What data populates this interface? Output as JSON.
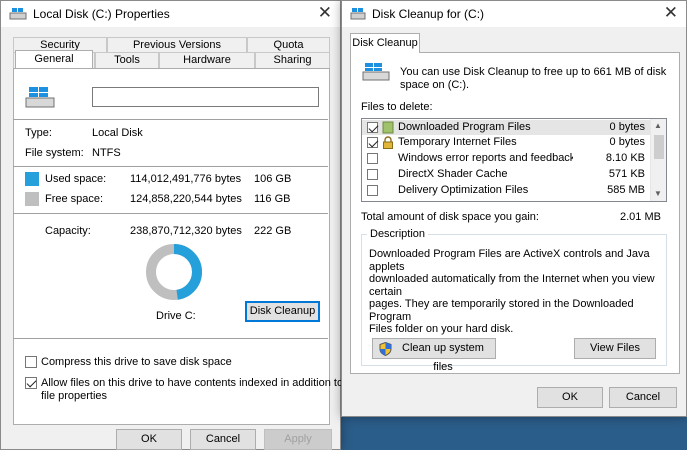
{
  "properties": {
    "title": "Local Disk (C:) Properties",
    "tabs_row1": [
      "Security",
      "Previous Versions",
      "Quota"
    ],
    "tabs_row2": [
      "General",
      "Tools",
      "Hardware",
      "Sharing"
    ],
    "volume_label_value": "",
    "type_label": "Type:",
    "type_value": "Local Disk",
    "fs_label": "File system:",
    "fs_value": "NTFS",
    "used_label": "Used space:",
    "used_bytes": "114,012,491,776 bytes",
    "used_gb": "106 GB",
    "free_label": "Free space:",
    "free_bytes": "124,858,220,544 bytes",
    "free_gb": "116 GB",
    "cap_label": "Capacity:",
    "cap_bytes": "238,870,712,320 bytes",
    "cap_gb": "222 GB",
    "drive_label": "Drive C:",
    "cleanup_button": "Disk Cleanup",
    "compress_label": "Compress this drive to save disk space",
    "compress_checked": false,
    "index_label_line1": "Allow files on this drive to have contents indexed in addition to",
    "index_label_line2": "file properties",
    "index_checked": true,
    "ok": "OK",
    "cancel": "Cancel",
    "apply": "Apply",
    "used_color": "#26a0da",
    "free_color": "#bfbfbf",
    "used_fraction": 0.477
  },
  "cleanup": {
    "title": "Disk Cleanup for  (C:)",
    "tab": "Disk Cleanup",
    "intro_line1": "You can use Disk Cleanup to free up to 661 MB of disk",
    "intro_line2": "space on  (C:).",
    "files_label": "Files to delete:",
    "files": [
      {
        "name": "Downloaded Program Files",
        "size": "0 bytes",
        "checked": true,
        "icon": "folder-icon"
      },
      {
        "name": "Temporary Internet Files",
        "size": "0 bytes",
        "checked": true,
        "icon": "lock-icon"
      },
      {
        "name": "Windows error reports and feedback di...",
        "size": "8.10 KB",
        "checked": false,
        "icon": "none"
      },
      {
        "name": "DirectX Shader Cache",
        "size": "571 KB",
        "checked": false,
        "icon": "none"
      },
      {
        "name": "Delivery Optimization Files",
        "size": "585 MB",
        "checked": false,
        "icon": "none"
      }
    ],
    "total_label": "Total amount of disk space you gain:",
    "total_value": "2.01 MB",
    "desc_title": "Description",
    "desc_line1": "Downloaded Program Files are ActiveX controls and Java applets",
    "desc_line2": "downloaded automatically from the Internet when you view certain",
    "desc_line3": "pages. They are temporarily stored in the Downloaded Program",
    "desc_line4": "Files folder on your hard disk.",
    "system_button": "Clean up system files",
    "view_button": "View Files",
    "ok": "OK",
    "cancel": "Cancel"
  }
}
